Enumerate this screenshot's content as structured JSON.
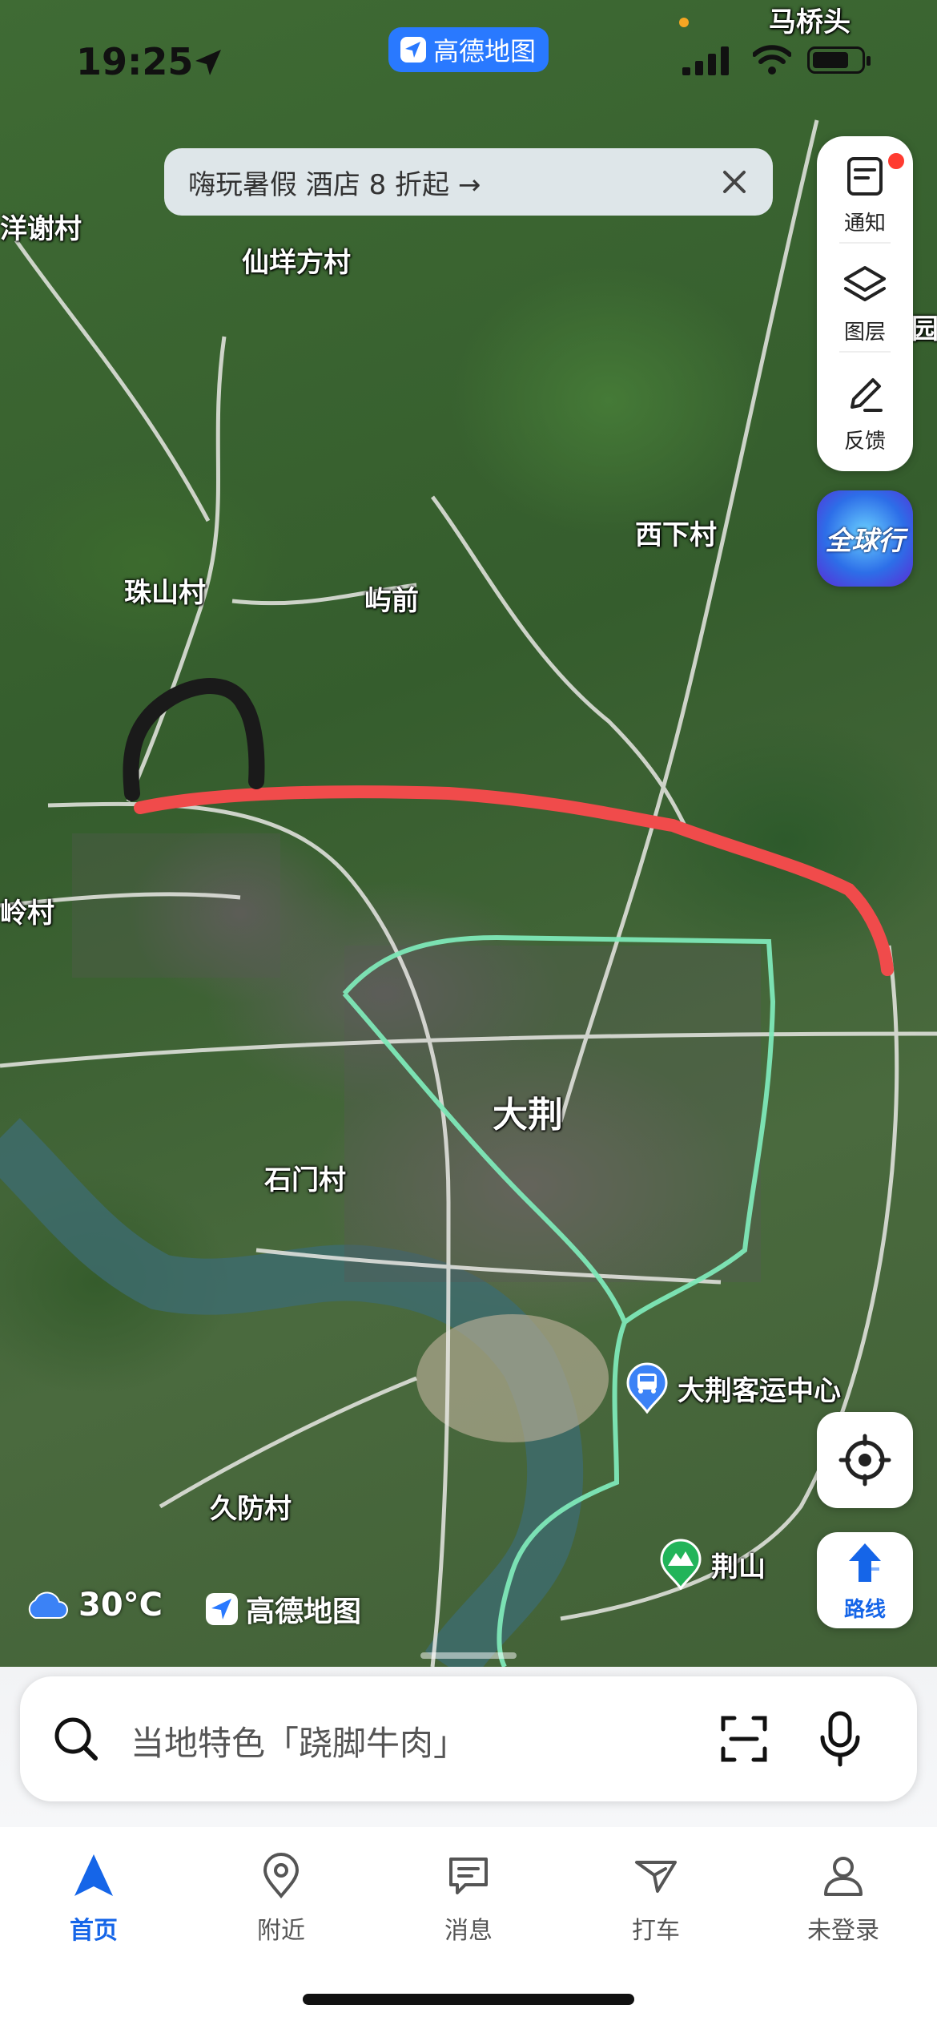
{
  "status_bar": {
    "time": "19:25",
    "brand_label": "高德地图",
    "top_right_place": "马桥头"
  },
  "promo_banner": {
    "text": "嗨玩暑假 酒店 8 折起 →",
    "close_icon": "close-icon"
  },
  "tools": [
    {
      "label": "通知",
      "icon": "notification-icon",
      "has_badge": true
    },
    {
      "label": "图层",
      "icon": "layers-icon"
    },
    {
      "label": "反馈",
      "icon": "edit-icon"
    }
  ],
  "globe_button": {
    "label": "全球行"
  },
  "map": {
    "places": [
      {
        "key": "xie",
        "label": "洋谢村"
      },
      {
        "key": "xianyang",
        "label": "仙垟方村"
      },
      {
        "key": "zhushan",
        "label": "珠山村"
      },
      {
        "key": "yuqian",
        "label": "屿前"
      },
      {
        "key": "xixia",
        "label": "西下村"
      },
      {
        "key": "ling",
        "label": "岭村"
      },
      {
        "key": "dajing",
        "label": "大荆"
      },
      {
        "key": "shimen",
        "label": "石门村"
      },
      {
        "key": "jiufang",
        "label": "久防村"
      },
      {
        "key": "yuan",
        "label": "园"
      }
    ],
    "pois": [
      {
        "label": "大荆客运中心",
        "icon": "bus-station-icon",
        "color": "#3b82f6"
      },
      {
        "label": "荆山",
        "icon": "mountain-icon",
        "color": "#22b45a"
      }
    ],
    "annotation_colors": {
      "red_line": "#f04b4b",
      "black_arc": "#1a1a1a",
      "green_route": "#6fe3b0"
    }
  },
  "locate_button": {
    "icon": "locate-icon"
  },
  "route_button": {
    "label": "路线",
    "icon": "route-arrow-icon"
  },
  "weather": {
    "temp": "30°C",
    "icon": "cloud-icon"
  },
  "watermark": {
    "text": "高德地图"
  },
  "search": {
    "placeholder": "当地特色「跷脚牛肉」",
    "icons": [
      "search-icon",
      "scan-icon",
      "microphone-icon"
    ]
  },
  "tabs": [
    {
      "label": "首页",
      "icon": "navigation-arrow-icon",
      "active": true
    },
    {
      "label": "附近",
      "icon": "location-pin-icon"
    },
    {
      "label": "消息",
      "icon": "message-icon"
    },
    {
      "label": "打车",
      "icon": "taxi-icon"
    },
    {
      "label": "未登录",
      "icon": "user-icon"
    }
  ],
  "colors": {
    "accent": "#1565e8",
    "brand_blue": "#2979ff"
  }
}
